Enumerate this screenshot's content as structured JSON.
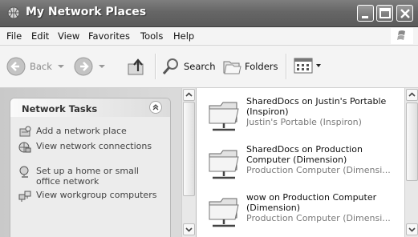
{
  "window": {
    "title": "My Network Places"
  },
  "menu": [
    "File",
    "Edit",
    "View",
    "Favorites",
    "Tools",
    "Help"
  ],
  "toolbar": {
    "back_label": "Back",
    "search_label": "Search",
    "folders_label": "Folders"
  },
  "tasks": {
    "title": "Network Tasks",
    "items": [
      {
        "label": "Add a network place",
        "icon": "add-network-place-icon"
      },
      {
        "label": "View network connections",
        "icon": "network-connections-icon"
      },
      {
        "label": "Set up a home or small office network",
        "icon": "home-network-icon"
      },
      {
        "label": "View workgroup computers",
        "icon": "workgroup-computers-icon"
      }
    ]
  },
  "places": [
    {
      "name": "SharedDocs on Justin's Portable (Inspiron)",
      "subtitle": "Justin's Portable (Inspiron)"
    },
    {
      "name": "SharedDocs on Production Computer (Dimension)",
      "subtitle": "Production Computer (Dimensi..."
    },
    {
      "name": "wow on Production Computer (Dimension)",
      "subtitle": "Production Computer (Dimensi..."
    }
  ],
  "colors": {
    "title_bar": "#666666",
    "task_pane": "#dcdcdc",
    "content_bg": "#ffffff"
  }
}
